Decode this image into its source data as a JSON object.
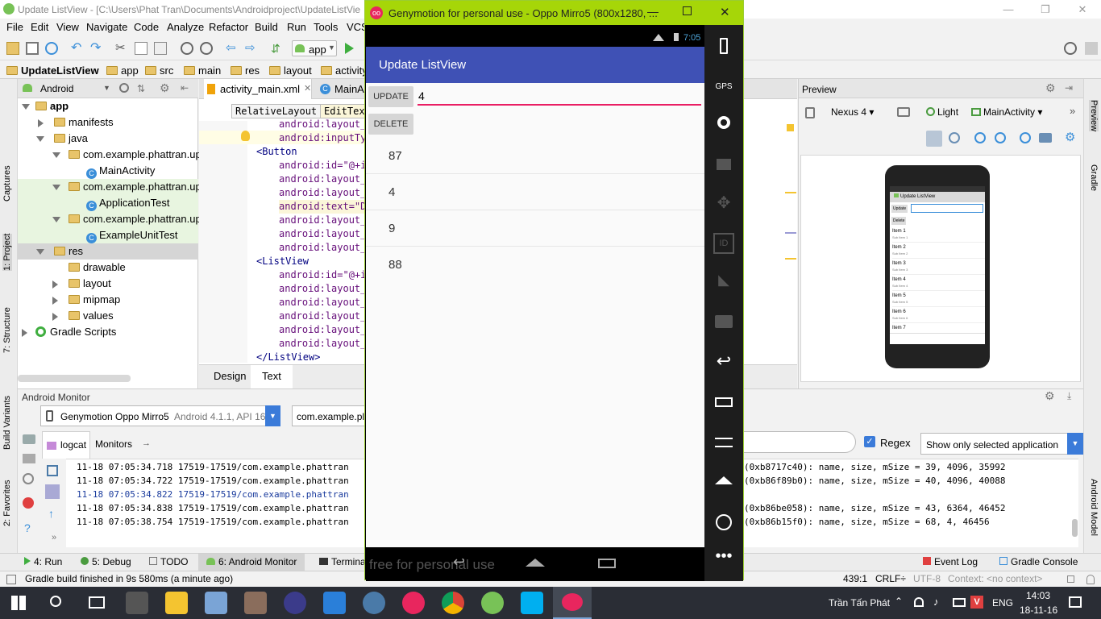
{
  "ide": {
    "title": "Update ListView - [C:\\Users\\Phat Tran\\Documents\\Androidproject\\UpdateListVie",
    "menu": [
      "File",
      "Edit",
      "View",
      "Navigate",
      "Code",
      "Analyze",
      "Refactor",
      "Build",
      "Run",
      "Tools",
      "VCS"
    ],
    "run_config": "app",
    "breadcrumbs": [
      "UpdateListView",
      "app",
      "src",
      "main",
      "res",
      "layout",
      "activity"
    ],
    "left_tabs": [
      "Captures",
      "1: Project",
      "7: Structure",
      "Build Variants",
      "2: Favorites"
    ],
    "right_tabs": [
      "Preview",
      "Gradle",
      "Android Model"
    ]
  },
  "project": {
    "view": "Android",
    "tree": [
      {
        "label": "app",
        "bold": true
      },
      {
        "label": "manifests"
      },
      {
        "label": "java"
      },
      {
        "label": "com.example.phattran.upd"
      },
      {
        "label": "MainActivity"
      },
      {
        "label": "com.example.phattran.upd"
      },
      {
        "label": "ApplicationTest"
      },
      {
        "label": "com.example.phattran.upd"
      },
      {
        "label": "ExampleUnitTest"
      },
      {
        "label": "res"
      },
      {
        "label": "drawable"
      },
      {
        "label": "layout"
      },
      {
        "label": "mipmap"
      },
      {
        "label": "values"
      },
      {
        "label": "Gradle Scripts"
      }
    ]
  },
  "editor": {
    "tabs": [
      "activity_main.xml",
      "MainA"
    ],
    "breadcrumb": [
      "RelativeLayout",
      "EditTex"
    ],
    "lines": [
      "android:layout_",
      "android:inputTy",
      "<Button",
      "android:id=\"@+i",
      "android:layout_",
      "android:layout_",
      "android:text=\"D",
      "android:layout_",
      "android:layout_",
      "android:layout_",
      "<ListView",
      "android:id=\"@+i",
      "android:layout_",
      "android:layout_",
      "android:layout_",
      "android:layout_",
      "android:layout_",
      "</ListView>"
    ],
    "bottom_tabs": [
      "Design",
      "Text"
    ]
  },
  "preview": {
    "title": "Preview",
    "device": "Nexus 4",
    "theme": "Light",
    "activity": "MainActivity",
    "mock": {
      "app_title": "Update ListView",
      "update": "Update",
      "delete": "Delete",
      "items": [
        [
          "Item 1",
          "Sub Item 1"
        ],
        [
          "Item 2",
          "Sub Item 2"
        ],
        [
          "Item 3",
          "Sub Item 3"
        ],
        [
          "Item 4",
          "Sub Item 4"
        ],
        [
          "Item 5",
          "Sub Item 5"
        ],
        [
          "Item 6",
          "Sub Item 6"
        ],
        [
          "Item 7",
          ""
        ]
      ]
    }
  },
  "monitor": {
    "title": "Android Monitor",
    "device": "Genymotion Oppo Mirro5",
    "device_api": "Android 4.1.1, API 16",
    "process": "com.example.pl",
    "tabs": [
      "logcat",
      "Monitors"
    ],
    "regex_label": "Regex",
    "filter": "Show only selected application",
    "log_left": [
      "11-18 07:05:34.718 17519-17519/com.example.phattran",
      "11-18 07:05:34.722 17519-17519/com.example.phattran",
      "11-18 07:05:34.822 17519-17519/com.example.phattran",
      "11-18 07:05:34.838 17519-17519/com.example.phattran",
      "11-18 07:05:38.754 17519-17519/com.example.phattran"
    ],
    "log_right": [
      "(0xb8717c40): name, size, mSize = 39, 4096, 35992",
      "(0xb86f89b0): name, size, mSize = 40, 4096, 40088",
      "",
      "(0xb86be058): name, size, mSize = 43, 6364, 46452",
      "(0xb86b15f0): name, size, mSize = 68, 4, 46456"
    ]
  },
  "bottom_tools": {
    "left": [
      "4: Run",
      "5: Debug",
      "TODO",
      "6: Android Monitor",
      "Terminal"
    ],
    "right": [
      "Event Log",
      "Gradle Console"
    ]
  },
  "status": {
    "message": "Gradle build finished in 9s 580ms (a minute ago)",
    "position": "439:1",
    "line_sep": "CRLF÷",
    "encoding": "UTF-8",
    "context": "Context: <no context>"
  },
  "geny": {
    "title": "Genymotion for personal use - Oppo Mirro5 (800x1280, ...",
    "time": "7:05",
    "app_title": "Update ListView",
    "update_btn": "UPDATE",
    "delete_btn": "DELETE",
    "input_value": "4",
    "list": [
      "87",
      "4",
      "9",
      "88"
    ],
    "watermark": "free for personal use",
    "sidebar_labels": [
      "GPS",
      "ID"
    ]
  },
  "taskbar": {
    "user": "Trần Tấn Phát",
    "lang": "ENG",
    "time": "14:03",
    "date": "18-11-16"
  },
  "colors": {
    "accent": "#3f51b5",
    "geny_green": "#a6d608",
    "pink": "#e91e63"
  }
}
